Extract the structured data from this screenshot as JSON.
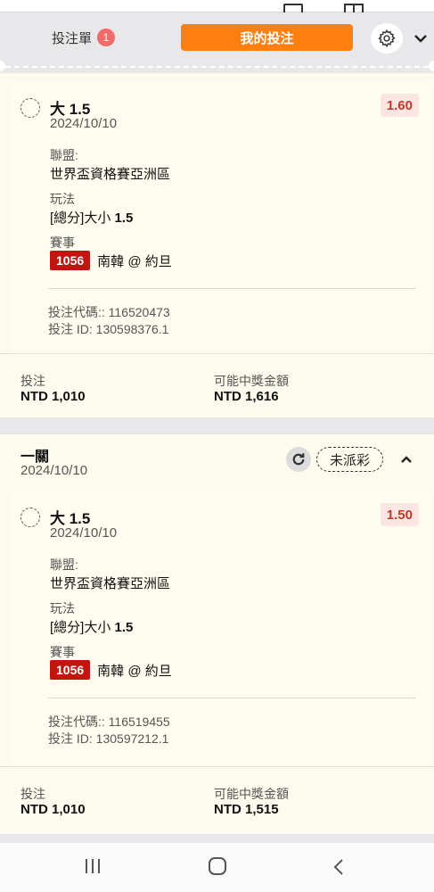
{
  "tabs": {
    "betslip_label": "投注單",
    "betslip_count": "1",
    "mybets_label": "我的投注",
    "accent_color": "#ff7f11"
  },
  "icons": {
    "settings": "gear-icon",
    "collapse": "chevron-down-icon",
    "refresh": "refresh-icon",
    "expand": "chevron-up-icon"
  },
  "bets": [
    {
      "selection": {
        "title": "大 1.5",
        "date": "2024/10/10",
        "odds": "1.60",
        "league_label": "聯盟:",
        "league": "世界盃資格賽亞洲區",
        "market_label": "玩法",
        "market_prefix": "[總分]大小",
        "market_line": "1.5",
        "event_label": "賽事",
        "event_id": "1056",
        "event_name": "南韓 @ 約旦",
        "bet_code": "投注代碼:: 116520473",
        "bet_id": "投注 ID: 130598376.1"
      },
      "stake_label": "投注",
      "stake": "NTD 1,010",
      "win_label": "可能中獎金額",
      "win": "NTD 1,616"
    },
    {
      "header": {
        "title": "一關",
        "date": "2024/10/10",
        "status": "未派彩"
      },
      "selection": {
        "title": "大 1.5",
        "date": "2024/10/10",
        "odds": "1.50",
        "league_label": "聯盟:",
        "league": "世界盃資格賽亞洲區",
        "market_label": "玩法",
        "market_prefix": "[總分]大小",
        "market_line": "1.5",
        "event_label": "賽事",
        "event_id": "1056",
        "event_name": "南韓 @ 約旦",
        "bet_code": "投注代碼:: 116519455",
        "bet_id": "投注 ID: 130597212.1"
      },
      "stake_label": "投注",
      "stake": "NTD 1,010",
      "win_label": "可能中獎金額",
      "win": "NTD 1,515"
    }
  ]
}
